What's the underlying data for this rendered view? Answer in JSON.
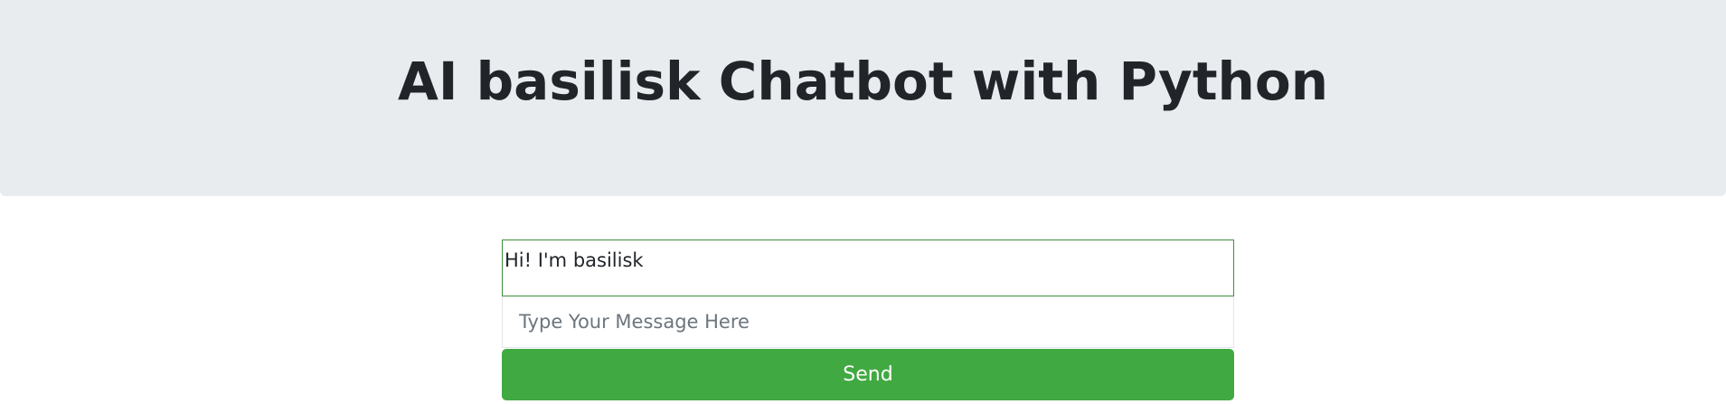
{
  "header": {
    "title": "AI basilisk Chatbot with Python"
  },
  "chat": {
    "messages": [
      {
        "sender": "bot",
        "text": "Hi! I'm basilisk"
      }
    ],
    "input": {
      "value": "",
      "placeholder": "Type Your Message Here"
    },
    "send_label": "Send"
  },
  "colors": {
    "header_bg": "#e9ecef",
    "title_text": "#212529",
    "chatbox_border": "#3e8f3a",
    "send_button_bg": "#41a942",
    "send_button_text": "#ffffff",
    "placeholder_text": "#6c757d"
  }
}
